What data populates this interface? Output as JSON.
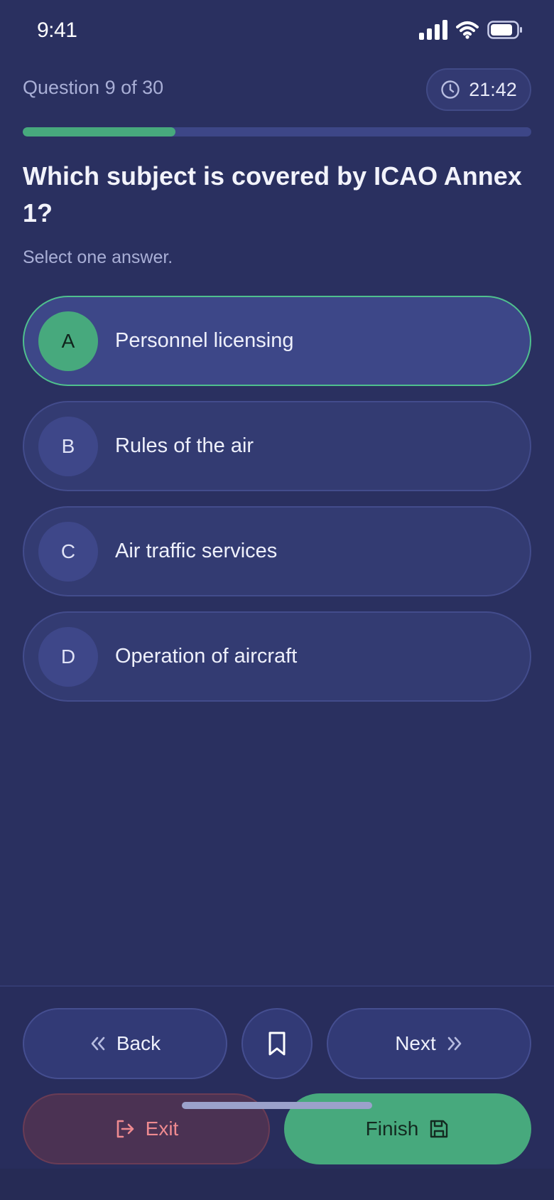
{
  "status_bar": {
    "time": "9:41",
    "icons": [
      "signal-icon",
      "wifi-icon",
      "battery-icon"
    ]
  },
  "header": {
    "question_counter": "Question 9 of 30",
    "timer": "21:42",
    "timer_icon": "clock-icon"
  },
  "progress": {
    "current": 9,
    "total": 30,
    "fraction": 0.3
  },
  "question": {
    "text": "Which subject is covered by ICAO Annex 1?",
    "instruction": "Select one answer."
  },
  "options": [
    {
      "letter": "A",
      "text": "Personnel licensing",
      "selected": true
    },
    {
      "letter": "B",
      "text": "Rules of the air",
      "selected": false
    },
    {
      "letter": "C",
      "text": "Air traffic services",
      "selected": false
    },
    {
      "letter": "D",
      "text": "Operation of aircraft",
      "selected": false
    }
  ],
  "footer": {
    "back_label": "Back",
    "next_label": "Next",
    "exit_label": "Exit",
    "finish_label": "Finish",
    "bookmark_icon": "bookmark-icon"
  },
  "colors": {
    "background": "#2a3060",
    "accent_green": "#47a97d",
    "selected_border": "#4fc08e",
    "exit_red": "#ee8a90"
  }
}
